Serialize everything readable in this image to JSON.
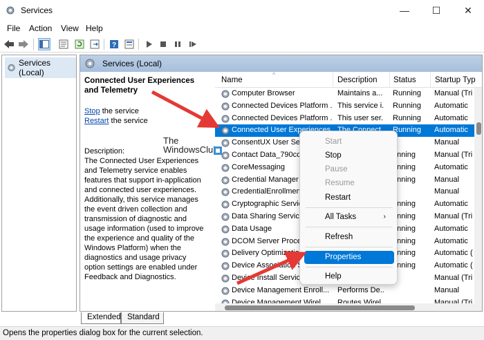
{
  "window": {
    "title": "Services",
    "minimize": "—",
    "maximize": "☐",
    "close": "✕"
  },
  "menu": [
    "File",
    "Action",
    "View",
    "Help"
  ],
  "tree": {
    "root": "Services (Local)"
  },
  "panel": {
    "header": "Services (Local)"
  },
  "details": {
    "service_title": "Connected User Experiences and Telemetry",
    "stop_link": "Stop",
    "stop_rest": " the service",
    "restart_link": "Restart",
    "restart_rest": " the service",
    "description_label": "Description:",
    "description_text": "The Connected User Experiences and Telemetry service enables features that support in-application and connected user experiences. Additionally, this service manages the event driven collection and transmission of diagnostic and usage information (used to improve the experience and quality of the Windows Platform) when the diagnostics and usage privacy option settings are enabled under Feedback and Diagnostics."
  },
  "watermark": {
    "line1": "The",
    "line2": "WindowsClub"
  },
  "columns": {
    "name": "Name",
    "description": "Description",
    "status": "Status",
    "startup": "Startup Typ"
  },
  "rows": [
    {
      "name": "Computer Browser",
      "desc": "Maintains a...",
      "status": "Running",
      "startup": "Manual (Tri"
    },
    {
      "name": "Connected Devices Platform ...",
      "desc": "This service i...",
      "status": "Running",
      "startup": "Automatic"
    },
    {
      "name": "Connected Devices Platform ...",
      "desc": "This user ser...",
      "status": "Running",
      "startup": "Automatic"
    },
    {
      "name": "Connected User Experiences ...",
      "desc": "The Connect...",
      "status": "Running",
      "startup": "Automatic"
    },
    {
      "name": "ConsentUX User Serv",
      "desc": "",
      "status": "",
      "startup": "Manual"
    },
    {
      "name": "Contact Data_790cc7",
      "desc": "",
      "status": "unning",
      "startup": "Manual (Tri"
    },
    {
      "name": "CoreMessaging",
      "desc": "",
      "status": "unning",
      "startup": "Automatic"
    },
    {
      "name": "Credential Manager",
      "desc": "",
      "status": "unning",
      "startup": "Manual"
    },
    {
      "name": "CredentialEnrollment",
      "desc": "",
      "status": "",
      "startup": "Manual"
    },
    {
      "name": "Cryptographic Servic",
      "desc": "",
      "status": "unning",
      "startup": "Automatic"
    },
    {
      "name": "Data Sharing Service",
      "desc": "",
      "status": "unning",
      "startup": "Manual (Tri"
    },
    {
      "name": "Data Usage",
      "desc": "",
      "status": "unning",
      "startup": "Automatic"
    },
    {
      "name": "DCOM Server Proces",
      "desc": "",
      "status": "unning",
      "startup": "Automatic"
    },
    {
      "name": "Delivery Optimizatio",
      "desc": "",
      "status": "unning",
      "startup": "Automatic ("
    },
    {
      "name": "Device Association S",
      "desc": "",
      "status": "unning",
      "startup": "Automatic ("
    },
    {
      "name": "Device Install Service",
      "desc": "",
      "status": "",
      "startup": "Manual (Tri"
    },
    {
      "name": "Device Management Enroll...",
      "desc": "Performs De...",
      "status": "",
      "startup": "Manual"
    },
    {
      "name": "Device Management Wirel...",
      "desc": "Routes Wirel...",
      "status": "",
      "startup": "Manual (Tri"
    }
  ],
  "context_menu": {
    "start": "Start",
    "stop": "Stop",
    "pause": "Pause",
    "resume": "Resume",
    "restart": "Restart",
    "all_tasks": "All Tasks",
    "refresh": "Refresh",
    "properties": "Properties",
    "help": "Help"
  },
  "tabs": [
    "Extended",
    "Standard"
  ],
  "status_bar": "Opens the properties dialog box for the current selection.",
  "colors": {
    "selection": "#0078d7",
    "panel_header": "#b4c8e0",
    "arrow": "#e53935"
  },
  "icons": [
    "services-app-icon",
    "back-icon",
    "forward-icon",
    "console-tree-icon",
    "properties-icon",
    "refresh-icon",
    "export-icon",
    "help-icon",
    "play-icon",
    "stop-icon",
    "pause-icon",
    "restart-icon",
    "gear-icon"
  ]
}
